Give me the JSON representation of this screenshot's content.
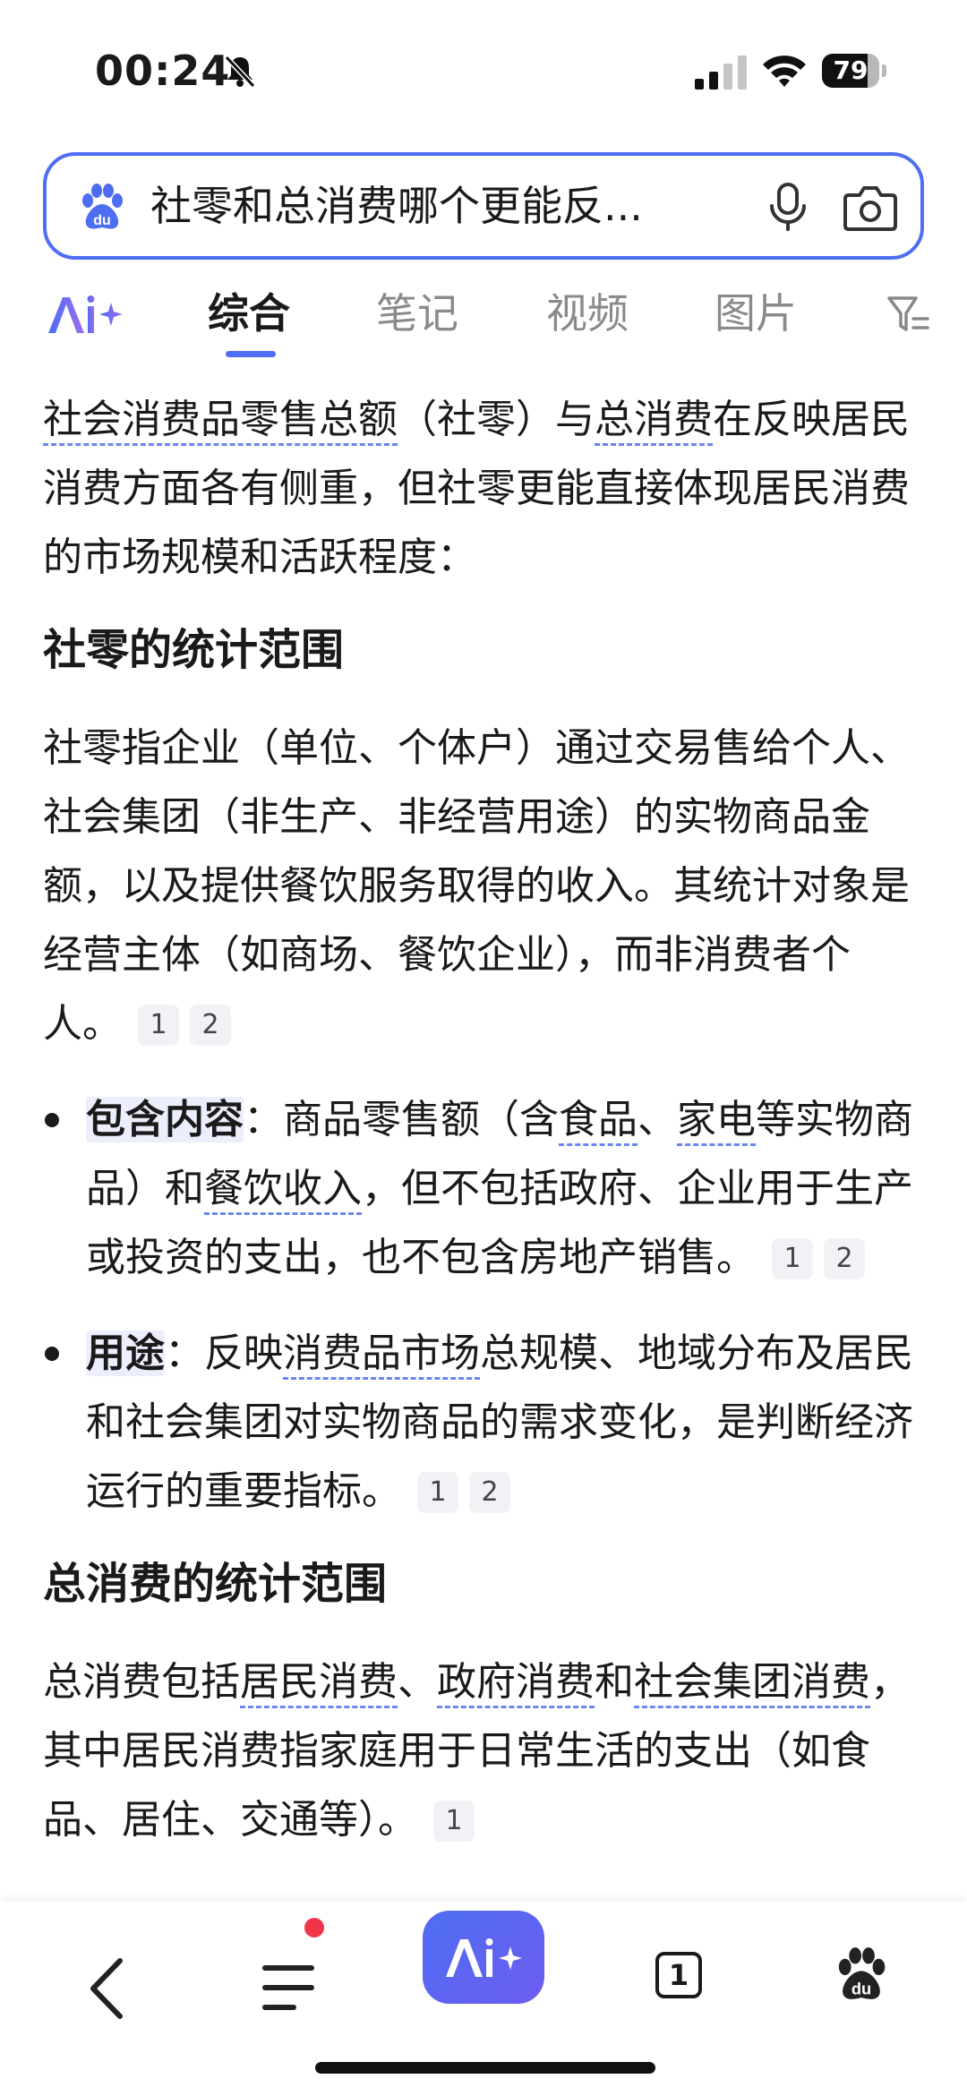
{
  "status_bar": {
    "time": "00:24",
    "battery": "79",
    "battery_level": 0.79
  },
  "search": {
    "query": "社零和总消费哪个更能反..."
  },
  "tabs": [
    {
      "label": "综合",
      "active": true
    },
    {
      "label": "笔记",
      "active": false
    },
    {
      "label": "视频",
      "active": false
    },
    {
      "label": "图片",
      "active": false
    }
  ],
  "content": {
    "intro": {
      "link1": "社会消费品零售总额",
      "t1": "（社零）与",
      "link2": "总消费",
      "t2": "在反映居民消费方面各有侧重，但社零更能直接体现居民消费的市场规模和活跃程度："
    },
    "heading1": "社零的统计范围",
    "para1": {
      "text": "社零指企业（单位、个体户）通过交易售给个人、社会集团（非生产、非经营用途）的实物商品金额，以及提供餐饮服务取得的收入。其统计对象是经营主体（如商场、餐饮企业），而非消费者个人。",
      "cites": [
        "1",
        "2"
      ]
    },
    "bullet1": {
      "label": "包含内容",
      "t1": "：商品零售额（含",
      "link1": "食品",
      "t2": "、",
      "link2": "家电",
      "t3": "等实物商品）和",
      "link3": "餐饮收入",
      "t4": "，但不包括政府、企业用于生产或投资的支出，也不包含房地产销售。",
      "cites": [
        "1",
        "2"
      ]
    },
    "bullet2": {
      "label": "用途",
      "t1": "：反映",
      "link1": "消费品市场",
      "t2": "总规模、地域分布及居民和社会集团对实物商品的需求变化，是判断经济运行的重要指标。",
      "cites": [
        "1",
        "2"
      ]
    },
    "heading2": "总消费的统计范围",
    "para2": {
      "t1": "总消费包括",
      "link1": "居民消费",
      "t2": "、",
      "link2": "政府消费",
      "t3": "和",
      "link3": "社会集团消费",
      "t4": "，其中居民消费指家庭用于日常生活的支出（如食品、居住、交通等）。",
      "cites": [
        "1"
      ]
    }
  },
  "bottom_nav": {
    "tab_count": "1"
  },
  "colors": {
    "accent": "#4e6ef2",
    "badge_red": "#f2344a"
  }
}
